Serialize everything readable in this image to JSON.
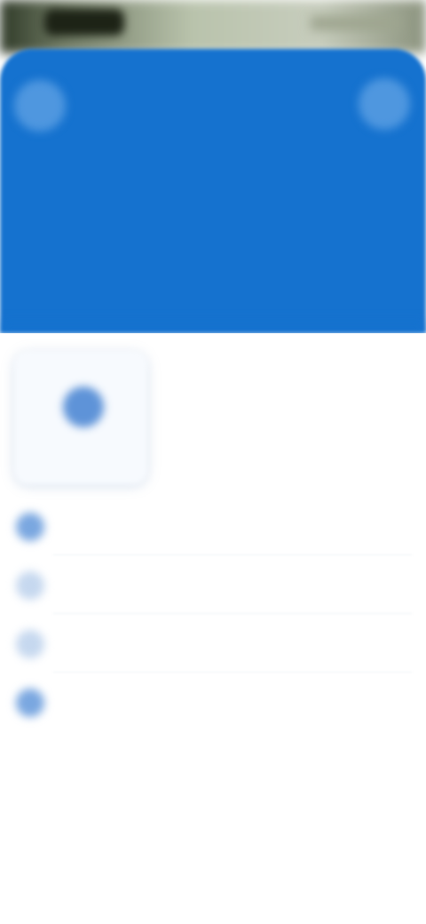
{
  "status_bar": {},
  "header": {
    "title": "",
    "subtitle": "",
    "menu_icon": "menu-icon",
    "profile_icon": "profile-icon",
    "color": "#1572cf"
  },
  "shortcut_card": {
    "label": "",
    "icon": "shortcut-icon"
  },
  "menu": {
    "items": [
      {
        "label": "",
        "icon": "item-icon"
      },
      {
        "label": "",
        "icon": "item-icon"
      },
      {
        "label": "",
        "icon": "item-icon"
      },
      {
        "label": "",
        "icon": "item-icon"
      }
    ]
  },
  "colors": {
    "accent": "#1572cf",
    "background": "#ffffff"
  }
}
